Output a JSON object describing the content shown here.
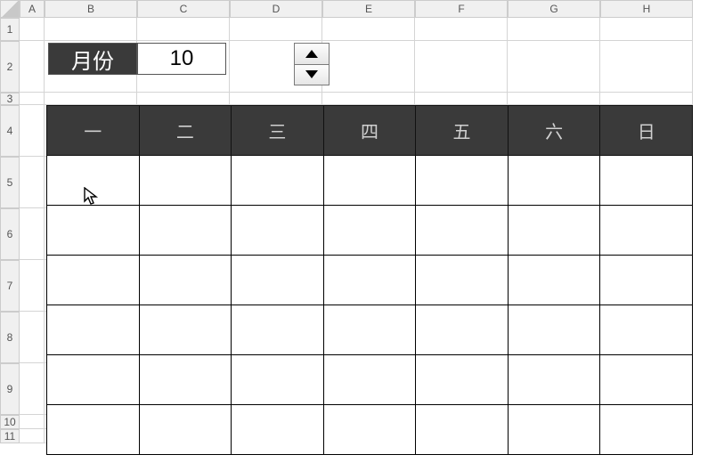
{
  "columns": [
    "A",
    "B",
    "C",
    "D",
    "E",
    "F",
    "G",
    "H"
  ],
  "rows": [
    "1",
    "2",
    "3",
    "4",
    "5",
    "6",
    "7",
    "8",
    "9",
    "10",
    "11"
  ],
  "month": {
    "label": "月份",
    "value": "10"
  },
  "weekdays": [
    "一",
    "二",
    "三",
    "四",
    "五",
    "六",
    "日"
  ],
  "calendar_rows": 6
}
